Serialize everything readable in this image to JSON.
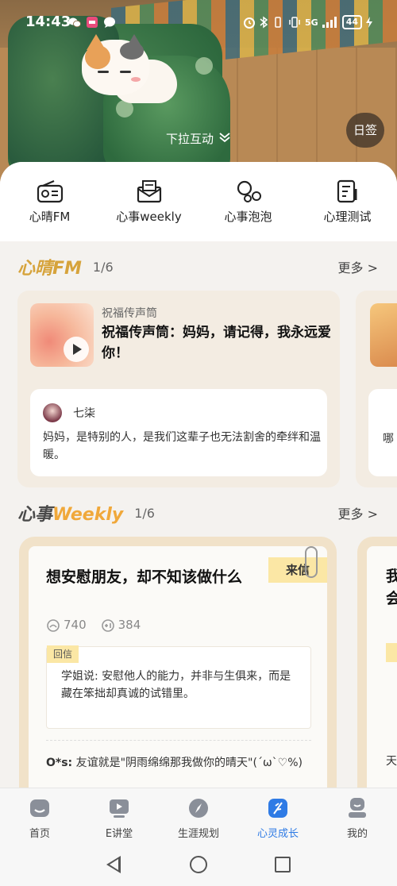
{
  "status_bar": {
    "time": "14:43",
    "network": "5G",
    "battery": "44"
  },
  "banner": {
    "pull_tip": "下拉互动",
    "checkin": "日签"
  },
  "quick_entries": [
    {
      "label": "心晴FM",
      "icon": "radio-icon"
    },
    {
      "label": "心事weekly",
      "icon": "mail-icon"
    },
    {
      "label": "心事泡泡",
      "icon": "bubbles-icon"
    },
    {
      "label": "心理测试",
      "icon": "test-paper-icon"
    }
  ],
  "fm_section": {
    "logo": "心晴FM",
    "page": "1/6",
    "more": "更多 >",
    "card": {
      "tag": "祝福传声筒",
      "title": "祝福传声筒：妈妈，请记得，我永远爱你！",
      "comment_user": "七柒",
      "comment_text": "妈妈，是特别的人，是我们这辈子也无法割舍的牵绊和温暖。"
    },
    "next_card_peek": "哪"
  },
  "weekly_section": {
    "logo_a": "心事",
    "logo_b": "Weekly",
    "page": "1/6",
    "more": "更多 >",
    "card": {
      "title": "想安慰朋友，却不知该做什么",
      "badge": "来信",
      "views": "740",
      "likes": "384",
      "reply_tag": "回信",
      "reply_text": "学姐说: 安慰他人的能力，并非与生俱来，而是藏在笨拙却真诚的试错里。",
      "comment_user": "O*s:",
      "comment_text": "友谊就是\"阴雨绵绵那我做你的晴天\"(´ω`♡%)"
    },
    "next_card_peek": {
      "title": "我会",
      "bottom": "天"
    }
  },
  "tabbar": [
    {
      "label": "首页",
      "icon": "home-icon"
    },
    {
      "label": "E讲堂",
      "icon": "video-lecture-icon"
    },
    {
      "label": "生涯规划",
      "icon": "compass-icon"
    },
    {
      "label": "心灵成长",
      "icon": "feather-icon"
    },
    {
      "label": "我的",
      "icon": "profile-icon"
    }
  ],
  "colors": {
    "active_tab": "#2f7be5",
    "accent_yellow": "#fbe7a5"
  }
}
